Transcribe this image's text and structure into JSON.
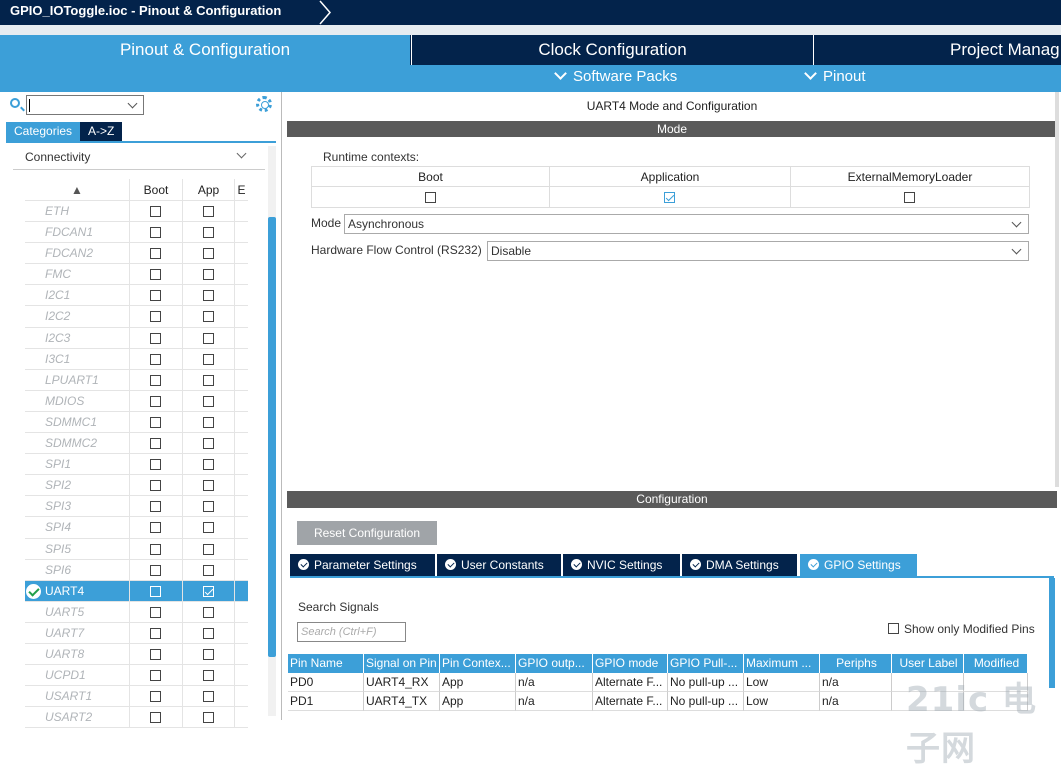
{
  "window": {
    "title": "GPIO_IOToggle.ioc - Pinout & Configuration"
  },
  "tabs": [
    "Pinout & Configuration",
    "Clock Configuration",
    "Project Manag"
  ],
  "subbar": {
    "software_packs": "Software Packs",
    "pinout": "Pinout"
  },
  "left": {
    "category_tabs": [
      "Categories",
      "A->Z"
    ],
    "category": "Connectivity",
    "columns": [
      "Boot",
      "App",
      "E"
    ],
    "peripherals": [
      {
        "name": "ETH",
        "boot": false,
        "app": false
      },
      {
        "name": "FDCAN1",
        "boot": false,
        "app": false
      },
      {
        "name": "FDCAN2",
        "boot": false,
        "app": false
      },
      {
        "name": "FMC",
        "boot": false,
        "app": false
      },
      {
        "name": "I2C1",
        "boot": false,
        "app": false
      },
      {
        "name": "I2C2",
        "boot": false,
        "app": false
      },
      {
        "name": "I2C3",
        "boot": false,
        "app": false
      },
      {
        "name": "I3C1",
        "boot": false,
        "app": false
      },
      {
        "name": "LPUART1",
        "boot": false,
        "app": false
      },
      {
        "name": "MDIOS",
        "boot": false,
        "app": false
      },
      {
        "name": "SDMMC1",
        "boot": false,
        "app": false
      },
      {
        "name": "SDMMC2",
        "boot": false,
        "app": false
      },
      {
        "name": "SPI1",
        "boot": false,
        "app": false
      },
      {
        "name": "SPI2",
        "boot": false,
        "app": false
      },
      {
        "name": "SPI3",
        "boot": false,
        "app": false
      },
      {
        "name": "SPI4",
        "boot": false,
        "app": false
      },
      {
        "name": "SPI5",
        "boot": false,
        "app": false
      },
      {
        "name": "SPI6",
        "boot": false,
        "app": false
      },
      {
        "name": "UART4",
        "boot": false,
        "app": true,
        "selected": true
      },
      {
        "name": "UART5",
        "boot": false,
        "app": false
      },
      {
        "name": "UART7",
        "boot": false,
        "app": false
      },
      {
        "name": "UART8",
        "boot": false,
        "app": false
      },
      {
        "name": "UCPD1",
        "boot": false,
        "app": false
      },
      {
        "name": "USART1",
        "boot": false,
        "app": false
      },
      {
        "name": "USART2",
        "boot": false,
        "app": false
      }
    ]
  },
  "right": {
    "header": "UART4 Mode and Configuration",
    "mode_bar": "Mode",
    "runtime_label": "Runtime contexts:",
    "contexts": [
      {
        "name": "Boot",
        "checked": false
      },
      {
        "name": "Application",
        "checked": true
      },
      {
        "name": "ExternalMemoryLoader",
        "checked": false
      }
    ],
    "mode_label": "Mode",
    "mode_value": "Asynchronous",
    "hfc_label": "Hardware Flow Control (RS232)",
    "hfc_value": "Disable",
    "config_bar": "Configuration",
    "reset_button": "Reset Configuration",
    "config_tabs": [
      "Parameter Settings",
      "User Constants",
      "NVIC Settings",
      "DMA Settings",
      "GPIO Settings"
    ],
    "search_label": "Search Signals",
    "search_placeholder": "Search (Ctrl+F)",
    "show_modified": "Show only Modified Pins",
    "gpio_columns": [
      "Pin Name",
      "Signal on Pin",
      "Pin Contex...",
      "GPIO outp...",
      "GPIO mode",
      "GPIO Pull-...",
      "Maximum ...",
      "Periphs",
      "User Label",
      "Modified"
    ],
    "gpio_rows": [
      [
        "PD0",
        "UART4_RX",
        "App",
        "n/a",
        "Alternate F...",
        "No pull-up ...",
        "Low",
        "n/a",
        "",
        ""
      ],
      [
        "PD1",
        "UART4_TX",
        "App",
        "n/a",
        "Alternate F...",
        "No pull-up ...",
        "Low",
        "n/a",
        "",
        ""
      ]
    ]
  },
  "watermark": "21ic 电子网"
}
